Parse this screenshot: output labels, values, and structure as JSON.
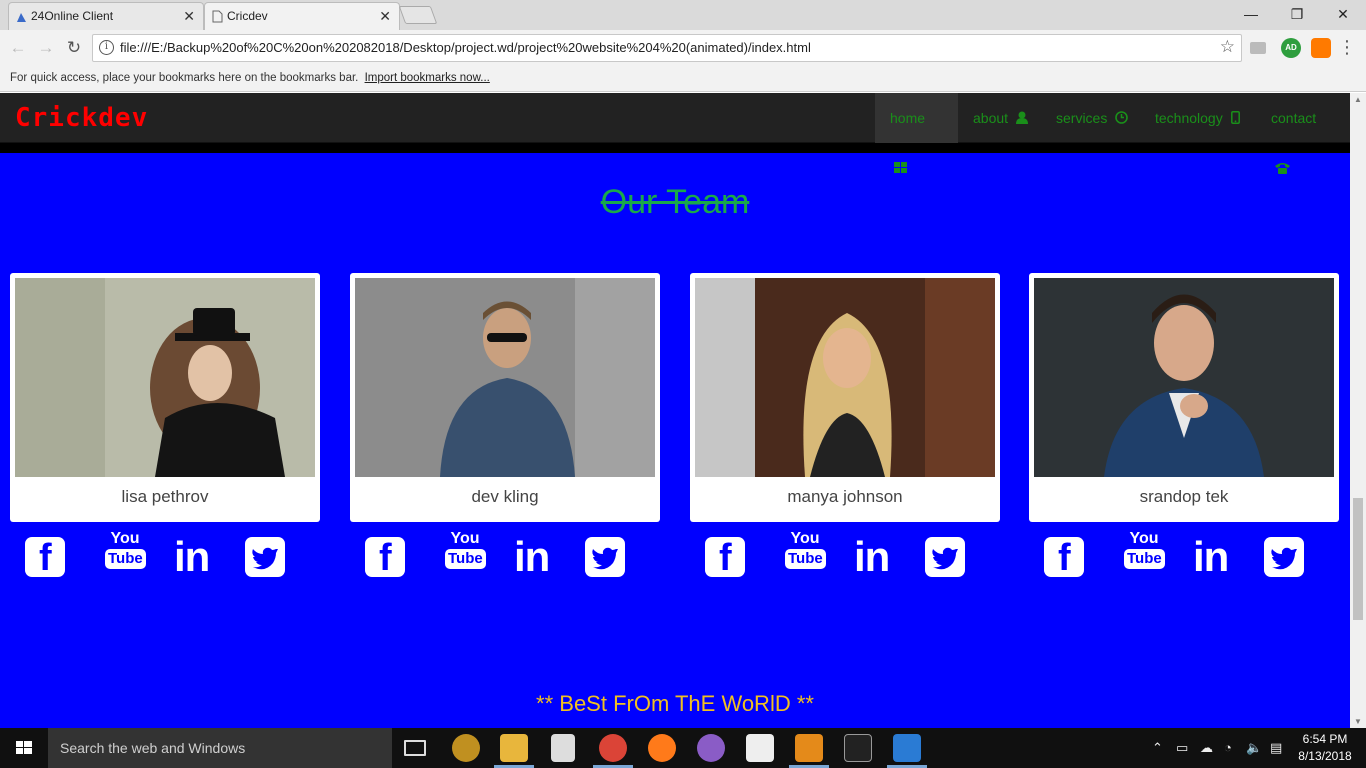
{
  "browser": {
    "tabs": [
      {
        "title": "24Online Client",
        "active": false
      },
      {
        "title": "Cricdev",
        "active": true
      }
    ],
    "url": "file:///E:/Backup%20of%20C%20on%202082018/Desktop/project.wd/project%20website%204%20(animated)/index.html",
    "bookmarks_hint": "For quick access, place your bookmarks here on the bookmarks bar.",
    "bookmarks_import": "Import bookmarks now...",
    "extension_badge": "AD"
  },
  "site": {
    "brand": "Crickdev",
    "nav": [
      {
        "label": "home",
        "icon": "grid-icon",
        "active": true
      },
      {
        "label": "about",
        "icon": "user-icon",
        "active": false
      },
      {
        "label": "services",
        "icon": "clock-icon",
        "active": false
      },
      {
        "label": "technology",
        "icon": "mobile-icon",
        "active": false
      },
      {
        "label": "contact",
        "icon": "phone-icon",
        "active": false
      }
    ],
    "section_title": "Our Team",
    "team": [
      {
        "name": "lisa pethrov"
      },
      {
        "name": "dev kling"
      },
      {
        "name": "manya johnson"
      },
      {
        "name": "srandop tek"
      }
    ],
    "social": {
      "youtube_top": "You",
      "youtube_bottom": "Tube",
      "linkedin": "in",
      "facebook": "f"
    },
    "tagline": "** BeSt FrOm ThE WoRlD **"
  },
  "taskbar": {
    "search_placeholder": "Search the web and Windows",
    "time": "6:54 PM",
    "date": "8/13/2018"
  },
  "colors": {
    "page_bg": "#0000ff",
    "brand": "#ff0000",
    "nav_text": "#1a8f1a",
    "title": "#1aa84a",
    "tagline": "#f0c020"
  }
}
